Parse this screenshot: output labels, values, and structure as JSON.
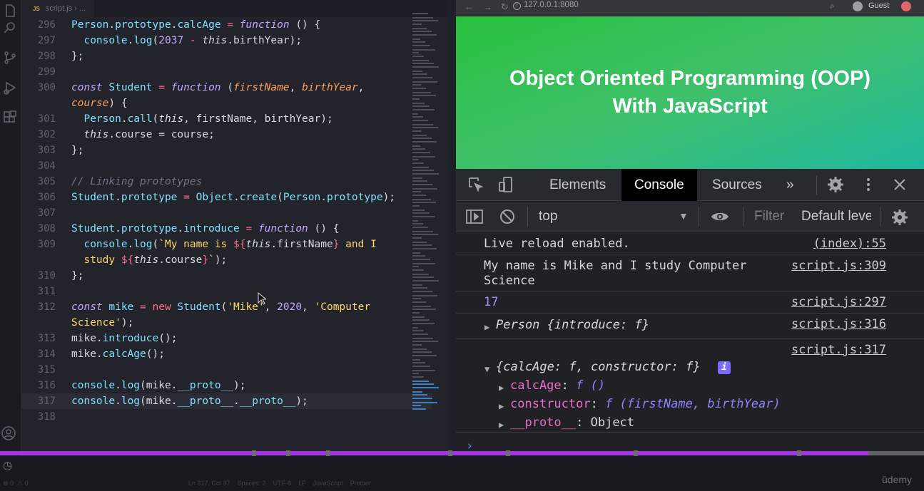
{
  "editor": {
    "tab_label": "script.js",
    "tab_path": "› ...",
    "tab_lang_badge": "JS",
    "lines": [
      {
        "n": "296",
        "html": "<span class=\"obj\">Person</span><span class=\"pl\">.</span><span class=\"mb\">prototype</span><span class=\"pl\">.</span><span class=\"fn\">calcAge</span><span class=\"kw\"> = </span><span class=\"it\">function</span><span class=\"pl\"> () {</span>"
      },
      {
        "n": "297",
        "html": "<span class=\"pl\">  </span><span class=\"obj\">console</span><span class=\"pl\">.</span><span class=\"fn\">log</span><span class=\"pl\">(</span><span class=\"num\">2037</span><span class=\"kw\"> - </span><span class=\"th\">this</span><span class=\"pl\">.birthYear);</span>"
      },
      {
        "n": "298",
        "html": "<span class=\"pl\">};</span>"
      },
      {
        "n": "299",
        "html": ""
      },
      {
        "n": "300",
        "html": "<span class=\"it\">const</span><span class=\"pl\"> </span><span class=\"obj\">Student</span><span class=\"kw\"> = </span><span class=\"it\">function</span><span class=\"pl\"> (</span><span class=\"par\">firstName</span><span class=\"pl\">, </span><span class=\"par\">birthYear</span><span class=\"pl\">,</span>"
      },
      {
        "n": "",
        "html": "<span class=\"par\">course</span><span class=\"pl\">) {</span>"
      },
      {
        "n": "301",
        "html": "<span class=\"pl\">  </span><span class=\"obj\">Person</span><span class=\"pl\">.</span><span class=\"fn\">call</span><span class=\"pl\">(</span><span class=\"th\">this</span><span class=\"pl\">, firstName, birthYear);</span>"
      },
      {
        "n": "302",
        "html": "<span class=\"pl\">  </span><span class=\"th\">this</span><span class=\"pl\">.course = course;</span>"
      },
      {
        "n": "303",
        "html": "<span class=\"pl\">};</span>"
      },
      {
        "n": "304",
        "html": ""
      },
      {
        "n": "305",
        "html": "<span class=\"cm\">// Linking prototypes</span>"
      },
      {
        "n": "306",
        "html": "<span class=\"obj\">Student</span><span class=\"pl\">.</span><span class=\"mb\">prototype</span><span class=\"kw\"> = </span><span class=\"obj\">Object</span><span class=\"pl\">.</span><span class=\"fn\">create</span><span class=\"pl\">(</span><span class=\"obj\">Person</span><span class=\"pl\">.</span><span class=\"mb\">prototype</span><span class=\"pl\">);</span>"
      },
      {
        "n": "307",
        "html": ""
      },
      {
        "n": "308",
        "html": "<span class=\"obj\">Student</span><span class=\"pl\">.</span><span class=\"mb\">prototype</span><span class=\"pl\">.</span><span class=\"fn\">introduce</span><span class=\"kw\"> = </span><span class=\"it\">function</span><span class=\"pl\"> () {</span>"
      },
      {
        "n": "309",
        "html": "<span class=\"pl\">  </span><span class=\"obj\">console</span><span class=\"pl\">.</span><span class=\"fn\">log</span><span class=\"pl\">(</span><span class=\"str\">`My name is </span><span class=\"kw\">${</span><span class=\"th\">this</span><span class=\"pl\">.firstName</span><span class=\"kw\">}</span><span class=\"str\"> and I</span>"
      },
      {
        "n": "",
        "html": "<span class=\"str\">  study </span><span class=\"kw\">${</span><span class=\"th\">this</span><span class=\"pl\">.course</span><span class=\"kw\">}</span><span class=\"str\">`</span><span class=\"pl\">);</span>"
      },
      {
        "n": "310",
        "html": "<span class=\"pl\">};</span>"
      },
      {
        "n": "311",
        "html": ""
      },
      {
        "n": "312",
        "html": "<span class=\"it\">const</span><span class=\"pl\"> </span><span class=\"obj\">mike</span><span class=\"kw\"> = new </span><span class=\"obj\">Student</span><span class=\"pl\">(</span><span class=\"str\">'Mike'</span><span class=\"pl\">, </span><span class=\"num\">2020</span><span class=\"pl\">, </span><span class=\"str\">'Computer</span>"
      },
      {
        "n": "",
        "html": "<span class=\"str\">Science'</span><span class=\"pl\">);</span>"
      },
      {
        "n": "313",
        "html": "<span class=\"pl\">mike.</span><span class=\"fn\">introduce</span><span class=\"pl\">();</span>"
      },
      {
        "n": "314",
        "html": "<span class=\"pl\">mike.</span><span class=\"fn\">calcAge</span><span class=\"pl\">();</span>"
      },
      {
        "n": "315",
        "html": ""
      },
      {
        "n": "316",
        "html": "<span class=\"obj\">console</span><span class=\"pl\">.</span><span class=\"fn\">log</span><span class=\"pl\">(mike.</span><span class=\"mb\">__proto__</span><span class=\"pl\">);</span>"
      },
      {
        "n": "317",
        "html": "<span class=\"obj\">console</span><span class=\"pl\">.</span><span class=\"fn\">log</span><span class=\"pl\">(mike.</span><span class=\"mb\">__proto__</span><span class=\"pl\">.</span><span class=\"mb\">__proto__</span><span class=\"pl\">);</span>"
      },
      {
        "n": "318",
        "html": ""
      }
    ],
    "active_line": "317"
  },
  "browser": {
    "url": "127.0.0.1:8080",
    "profile": "Guest",
    "banner_line1": "Object Oriented Programming (OOP)",
    "banner_line2": "With JavaScript"
  },
  "devtools": {
    "tabs": [
      "Elements",
      "Console",
      "Sources"
    ],
    "selected_tab": "Console",
    "context": "top",
    "filter_placeholder": "Filter",
    "levels": "Default levels",
    "messages": {
      "live_reload": "Live reload enabled.",
      "live_reload_src": "(index):55",
      "intro_line1": "My name is Mike and I study Computer",
      "intro_line2": "Science",
      "intro_src": "script.js:309",
      "age": "17",
      "age_src": "script.js:297",
      "person_label": "Person",
      "person_body": "{introduce: f}",
      "person_src": "script.js:316",
      "proto_src": "script.js:317",
      "proto_summary": "{calcAge: f, constructor: f}",
      "info_badge": "i",
      "calcage_key": "calcAge",
      "calcage_val": "f ()",
      "ctor_key": "constructor",
      "ctor_val": "f (firstName, birthYear)",
      "proto_key": "__proto__",
      "proto_val": "Object"
    }
  },
  "video": {
    "progress": 0.94,
    "chapters": [
      0.275,
      0.312,
      0.355,
      0.487,
      0.55,
      0.688,
      0.865
    ]
  },
  "status": {
    "left": "⊗ 0  ⚠ 0",
    "right": "Ln 317, Col 37    Spaces: 2    UTF-8    LF    JavaScript    Prettier",
    "brand": "ūdemy"
  },
  "colors": {
    "accent_purple": "#a335e8",
    "banner_green": "#28c13d",
    "console_number": "#a48bff"
  }
}
